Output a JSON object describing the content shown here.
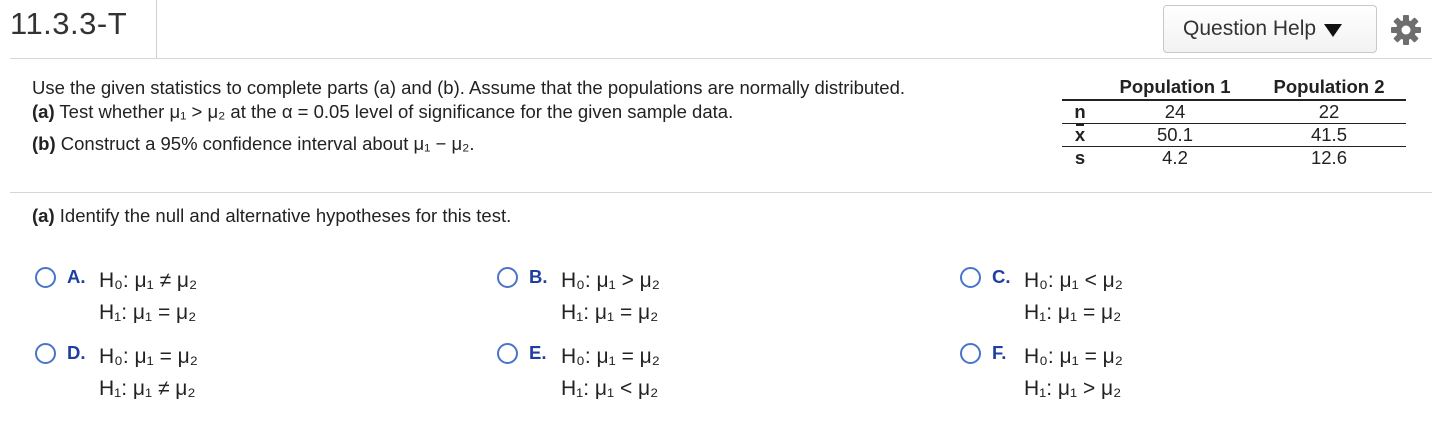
{
  "question_id": "11.3.3-T",
  "help_button_label": "Question Help",
  "intro": {
    "line1": "Use the given statistics to complete parts (a) and (b). Assume that the populations are normally distributed.",
    "line2_label": "(a)",
    "line2_text": " Test whether μ₁ > μ₂ at the α = 0.05 level of significance for the given sample data.",
    "line3_label": "(b)",
    "line3_text": " Construct a 95% confidence interval about μ₁ − μ₂."
  },
  "stats_table": {
    "headers": [
      "Population 1",
      "Population 2"
    ],
    "rows": [
      {
        "label": "n",
        "values": [
          "24",
          "22"
        ]
      },
      {
        "label": "x",
        "values": [
          "50.1",
          "41.5"
        ]
      },
      {
        "label": "s",
        "values": [
          "4.2",
          "12.6"
        ]
      }
    ]
  },
  "part_a": {
    "label": "(a)",
    "prompt": " Identify the null and alternative hypotheses for this test."
  },
  "choices": [
    {
      "letter": "A.",
      "h0": "H₀: μ₁ ≠ μ₂",
      "h1": "H₁: μ₁ = μ₂"
    },
    {
      "letter": "B.",
      "h0": "H₀: μ₁ > μ₂",
      "h1": "H₁: μ₁ = μ₂"
    },
    {
      "letter": "C.",
      "h0": "H₀: μ₁ < μ₂",
      "h1": "H₁: μ₁ = μ₂"
    },
    {
      "letter": "D.",
      "h0": "H₀: μ₁ = μ₂",
      "h1": "H₁: μ₁ ≠ μ₂"
    },
    {
      "letter": "E.",
      "h0": "H₀: μ₁ = μ₂",
      "h1": "H₁: μ₁ < μ₂"
    },
    {
      "letter": "F.",
      "h0": "H₀: μ₁ = μ₂",
      "h1": "H₁: μ₁ > μ₂"
    }
  ],
  "colors": {
    "radio": "#4a74c9",
    "choice_letter": "#1f3fa0"
  }
}
